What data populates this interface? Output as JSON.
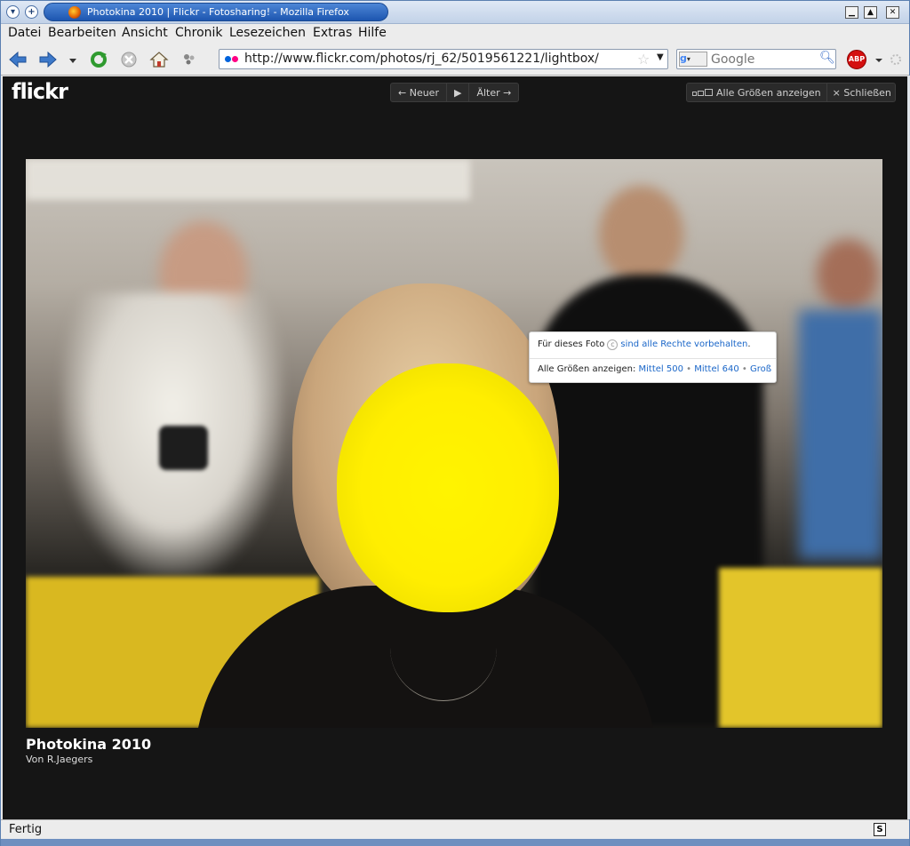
{
  "window": {
    "title": "Photokina 2010 | Flickr - Fotosharing! - Mozilla Firefox",
    "controls": {
      "minimize": "▁",
      "maximize": "▲",
      "close": "✕"
    }
  },
  "menubar": {
    "items": [
      {
        "label": "Datei"
      },
      {
        "label": "Bearbeiten"
      },
      {
        "label": "Ansicht"
      },
      {
        "label": "Chronik"
      },
      {
        "label": "Lesezeichen"
      },
      {
        "label": "Extras"
      },
      {
        "label": "Hilfe"
      }
    ]
  },
  "navbar": {
    "url": "http://www.flickr.com/photos/rj_62/5019561221/lightbox/",
    "search_placeholder": "Google",
    "abp_label": "ABP"
  },
  "lightbox": {
    "logo": "flickr",
    "pager": {
      "newer": "← Neuer",
      "play": "▶",
      "older": "Älter →"
    },
    "all_sizes": "Alle Größen anzeigen",
    "close": "× Schließen",
    "popup": {
      "rights_prefix": "Für dieses Foto",
      "rights_link": "sind alle Rechte vorbehalten",
      "sizes_prefix": "Alle Größen anzeigen:",
      "sizes": [
        "Mittel 500",
        "Mittel 640",
        "Groß"
      ]
    },
    "caption": {
      "title": "Photokina 2010",
      "author": "Von R.Jaegers"
    }
  },
  "statusbar": {
    "text": "Fertig"
  },
  "colors": {
    "flickr_blue": "#0063dc",
    "flickr_pink": "#ff0084",
    "link": "#1a66c8"
  }
}
